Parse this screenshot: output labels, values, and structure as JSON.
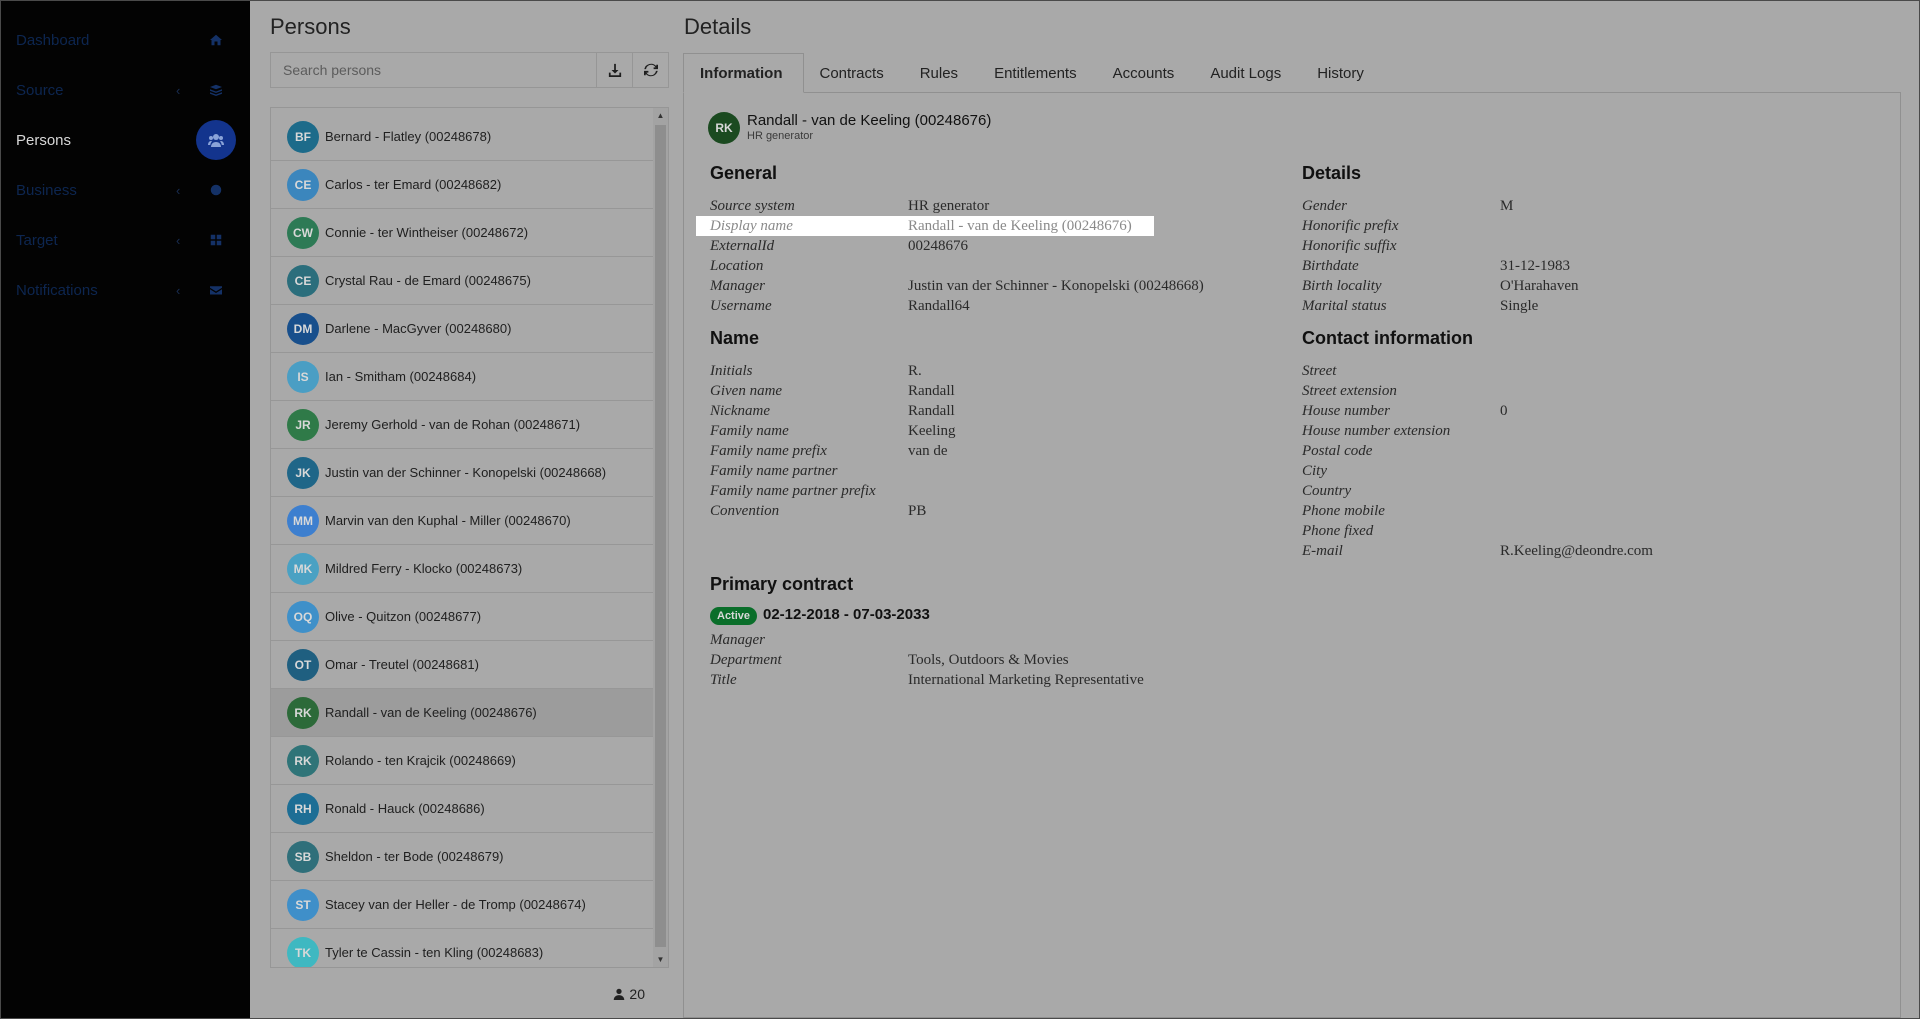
{
  "sidebar": {
    "items": [
      {
        "label": "Dashboard",
        "icon": "home-icon",
        "chevron": false,
        "active": false
      },
      {
        "label": "Source",
        "icon": "database-icon",
        "chevron": true,
        "active": false
      },
      {
        "label": "Persons",
        "icon": "users-icon",
        "chevron": false,
        "active": true
      },
      {
        "label": "Business",
        "icon": "globe-icon",
        "chevron": true,
        "active": false
      },
      {
        "label": "Target",
        "icon": "grid-icon",
        "chevron": true,
        "active": false
      },
      {
        "label": "Notifications",
        "icon": "envelope-icon",
        "chevron": true,
        "active": false
      }
    ],
    "chevron_glyph": "‹"
  },
  "persons": {
    "title": "Persons",
    "search_placeholder": "Search persons",
    "count": "20",
    "rows": [
      {
        "initials": "BF",
        "name": "Bernard - Flatley (00248678)",
        "color": "#1d6b8a"
      },
      {
        "initials": "CE",
        "name": "Carlos - ter Emard (00248682)",
        "color": "#3b86bd"
      },
      {
        "initials": "CW",
        "name": "Connie - ter Wintheiser (00248672)",
        "color": "#2d7a55"
      },
      {
        "initials": "CE",
        "name": "Crystal Rau - de Emard (00248675)",
        "color": "#2b6e7c"
      },
      {
        "initials": "DM",
        "name": "Darlene - MacGyver (00248680)",
        "color": "#184f8c"
      },
      {
        "initials": "IS",
        "name": "Ian - Smitham (00248684)",
        "color": "#4a9ec4"
      },
      {
        "initials": "JR",
        "name": "Jeremy Gerhold - van de Rohan (00248671)",
        "color": "#2f7a48"
      },
      {
        "initials": "JK",
        "name": "Justin van der Schinner - Konopelski (00248668)",
        "color": "#1f6688"
      },
      {
        "initials": "MM",
        "name": "Marvin van den Kuphal - Miller (00248670)",
        "color": "#3d7fcf"
      },
      {
        "initials": "MK",
        "name": "Mildred Ferry - Klocko (00248673)",
        "color": "#4aa1c3"
      },
      {
        "initials": "OQ",
        "name": "Olive - Quitzon (00248677)",
        "color": "#3f90c9"
      },
      {
        "initials": "OT",
        "name": "Omar - Treutel (00248681)",
        "color": "#1f5f80"
      },
      {
        "initials": "RK",
        "name": "Randall - van de Keeling (00248676)",
        "color": "#2c6a39"
      },
      {
        "initials": "RK",
        "name": "Rolando - ten Krajcik (00248669)",
        "color": "#2f7478"
      },
      {
        "initials": "RH",
        "name": "Ronald - Hauck (00248686)",
        "color": "#1d6e95"
      },
      {
        "initials": "SB",
        "name": "Sheldon - ter Bode (00248679)",
        "color": "#2f6f7a"
      },
      {
        "initials": "ST",
        "name": "Stacey van der Heller - de Tromp (00248674)",
        "color": "#3f8fc9"
      },
      {
        "initials": "TK",
        "name": "Tyler te Cassin - ten Kling (00248683)",
        "color": "#3fb8c1"
      }
    ],
    "selected_index": 12
  },
  "details": {
    "title": "Details",
    "tabs": [
      "Information",
      "Contracts",
      "Rules",
      "Entitlements",
      "Accounts",
      "Audit Logs",
      "History"
    ],
    "active_tab": 0,
    "person": {
      "initials": "RK",
      "name": "Randall - van de Keeling (00248676)",
      "source": "HR generator"
    },
    "general": {
      "title": "General",
      "fields": [
        {
          "label": "Source system",
          "value": "HR generator"
        },
        {
          "label": "Display name",
          "value": "Randall - van de Keeling (00248676)"
        },
        {
          "label": "ExternalId",
          "value": "00248676"
        },
        {
          "label": "Location",
          "value": ""
        },
        {
          "label": "Manager",
          "value": "Justin van der Schinner - Konopelski (00248668)"
        },
        {
          "label": "Username",
          "value": "Randall64"
        }
      ]
    },
    "name": {
      "title": "Name",
      "fields": [
        {
          "label": "Initials",
          "value": "R."
        },
        {
          "label": "Given name",
          "value": "Randall"
        },
        {
          "label": "Nickname",
          "value": "Randall"
        },
        {
          "label": "Family name",
          "value": "Keeling"
        },
        {
          "label": "Family name prefix",
          "value": "van de"
        },
        {
          "label": "Family name partner",
          "value": ""
        },
        {
          "label": "Family name partner prefix",
          "value": ""
        },
        {
          "label": "Convention",
          "value": "PB"
        }
      ]
    },
    "personal": {
      "title": "Details",
      "fields": [
        {
          "label": "Gender",
          "value": "M"
        },
        {
          "label": "Honorific prefix",
          "value": ""
        },
        {
          "label": "Honorific suffix",
          "value": ""
        },
        {
          "label": "Birthdate",
          "value": "31-12-1983"
        },
        {
          "label": "Birth locality",
          "value": "O'Harahaven"
        },
        {
          "label": "Marital status",
          "value": "Single"
        }
      ]
    },
    "contact": {
      "title": "Contact information",
      "fields": [
        {
          "label": "Street",
          "value": ""
        },
        {
          "label": "Street extension",
          "value": ""
        },
        {
          "label": "House number",
          "value": "0"
        },
        {
          "label": "House number extension",
          "value": ""
        },
        {
          "label": "Postal code",
          "value": ""
        },
        {
          "label": "City",
          "value": ""
        },
        {
          "label": "Country",
          "value": ""
        },
        {
          "label": "Phone mobile",
          "value": ""
        },
        {
          "label": "Phone fixed",
          "value": ""
        },
        {
          "label": "E-mail",
          "value": "R.Keeling@deondre.com"
        }
      ]
    },
    "primary_contract": {
      "title": "Primary contract",
      "status": "Active",
      "dates": "02-12-2018 - 07-03-2033",
      "fields": [
        {
          "label": "Manager",
          "value": ""
        },
        {
          "label": "Department",
          "value": "Tools, Outdoors & Movies"
        },
        {
          "label": "Title",
          "value": "International Marketing Representative"
        }
      ]
    }
  }
}
